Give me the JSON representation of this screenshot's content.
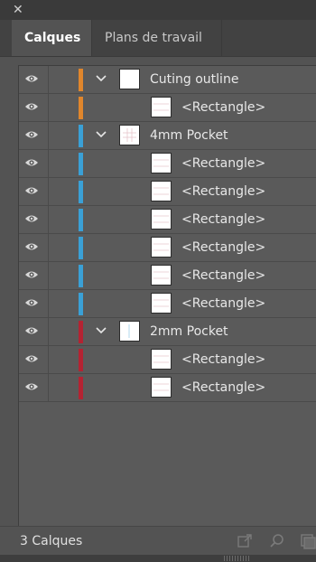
{
  "tabs": [
    {
      "label": "Calques"
    },
    {
      "label": "Plans de travail"
    }
  ],
  "colors": {
    "orange": "#e0862c",
    "blue": "#3aa0d6",
    "red": "#b42332"
  },
  "layers": [
    {
      "kind": "layer",
      "label": "Cuting outline",
      "color": "#e0862c",
      "expanded": true
    },
    {
      "kind": "sub",
      "label": "<Rectangle>",
      "color": "#e0862c"
    },
    {
      "kind": "layer",
      "label": "4mm Pocket",
      "color": "#3aa0d6",
      "expanded": true
    },
    {
      "kind": "sub",
      "label": "<Rectangle>",
      "color": "#3aa0d6"
    },
    {
      "kind": "sub",
      "label": "<Rectangle>",
      "color": "#3aa0d6"
    },
    {
      "kind": "sub",
      "label": "<Rectangle>",
      "color": "#3aa0d6"
    },
    {
      "kind": "sub",
      "label": "<Rectangle>",
      "color": "#3aa0d6"
    },
    {
      "kind": "sub",
      "label": "<Rectangle>",
      "color": "#3aa0d6"
    },
    {
      "kind": "sub",
      "label": "<Rectangle>",
      "color": "#3aa0d6"
    },
    {
      "kind": "layer",
      "label": "2mm Pocket",
      "color": "#b42332",
      "expanded": true
    },
    {
      "kind": "sub",
      "label": "<Rectangle>",
      "color": "#b42332"
    },
    {
      "kind": "sub",
      "label": "<Rectangle>",
      "color": "#b42332"
    }
  ],
  "footer": {
    "count_label": "3 Calques"
  },
  "icons": {
    "close": "close-icon",
    "visibility": "eye-icon",
    "expand": "chevron-down-icon",
    "export": "export-icon",
    "search": "search-icon",
    "new_layer": "new-layer-icon"
  }
}
